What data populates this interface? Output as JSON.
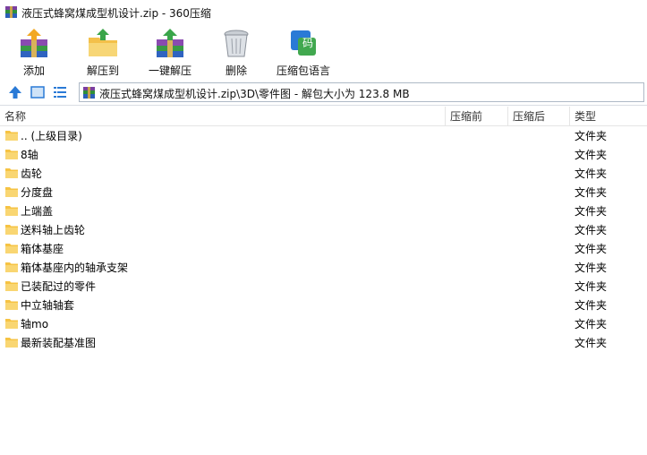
{
  "window": {
    "title": "液压式蜂窝煤成型机设计.zip - 360压缩",
    "app_icon": "winrar-archive-icon"
  },
  "toolbar": {
    "buttons": [
      {
        "label": "添加",
        "icon": "add-books-icon"
      },
      {
        "label": "解压到",
        "icon": "extract-folder-icon"
      },
      {
        "label": "一键解压",
        "icon": "one-click-extract-icon"
      },
      {
        "label": "删除",
        "icon": "trash-bin-icon"
      },
      {
        "label": "压缩包语言",
        "icon": "archive-language-icon"
      }
    ]
  },
  "nav": {
    "up_icon": "up-arrow-icon",
    "view_icon": "large-icon-view-icon",
    "list_icon": "list-view-icon"
  },
  "address": {
    "path": "液压式蜂窝煤成型机设计.zip\\3D\\零件图 - 解包大小为 123.8 MB"
  },
  "columns": {
    "name": "名称",
    "packed": "压缩前",
    "unpacked": "压缩后",
    "type": "类型"
  },
  "files": [
    {
      "name": ".. (上级目录)",
      "type": "文件夹"
    },
    {
      "name": "8轴",
      "type": "文件夹"
    },
    {
      "name": "齿轮",
      "type": "文件夹"
    },
    {
      "name": "分度盘",
      "type": "文件夹"
    },
    {
      "name": "上端盖",
      "type": "文件夹"
    },
    {
      "name": "送料轴上齿轮",
      "type": "文件夹"
    },
    {
      "name": "箱体基座",
      "type": "文件夹"
    },
    {
      "name": "箱体基座内的轴承支架",
      "type": "文件夹"
    },
    {
      "name": "已装配过的零件",
      "type": "文件夹"
    },
    {
      "name": "中立轴轴套",
      "type": "文件夹"
    },
    {
      "name": "轴mo",
      "type": "文件夹"
    },
    {
      "name": "最新装配基准图",
      "type": "文件夹"
    }
  ],
  "colors": {
    "folder": "#f6c343",
    "accent": "#2a7ad6"
  }
}
